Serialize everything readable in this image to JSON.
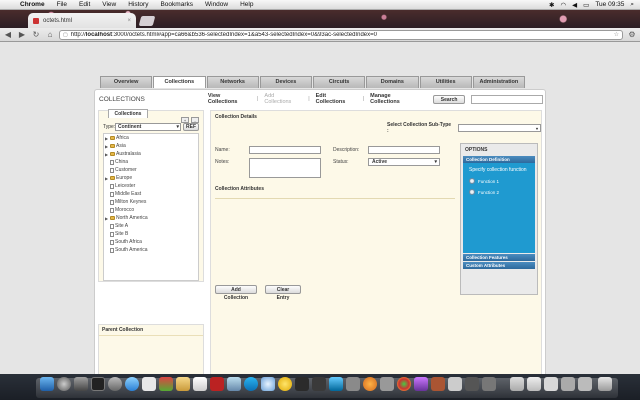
{
  "menubar": {
    "app": "Chrome",
    "items": [
      "File",
      "Edit",
      "View",
      "History",
      "Bookmarks",
      "Window",
      "Help"
    ],
    "clock": "Tue 09:35"
  },
  "browser": {
    "tab_title": "octets.html",
    "url_prefix": "http://",
    "url_host": "localhost",
    "url_rest": ":3000/octets.html#app=ca66&b536-selectedIndex=1&a543-selectedIndex=0&93ac-selectedIndex=0"
  },
  "nav_tabs": [
    "Overview",
    "Collections",
    "Networks",
    "Devices",
    "Circuits",
    "Domains",
    "Utilities",
    "Administration"
  ],
  "active_tab_index": 1,
  "page": {
    "title": "COLLECTIONS",
    "links": {
      "view": "View Collections",
      "add": "Add Collections",
      "edit": "Edit Collections",
      "manage": "Manage Collections"
    },
    "search_button": "Search",
    "search_value": ""
  },
  "left": {
    "tab_label": "Collections",
    "ref_button": "REF",
    "plus_button": "+",
    "minus_button": "-",
    "type_label": "Type:",
    "type_value": "Continent",
    "tree": [
      {
        "label": "Africa",
        "kind": "folder",
        "expandable": true
      },
      {
        "label": "Asia",
        "kind": "folder",
        "expandable": true
      },
      {
        "label": "Australasia",
        "kind": "folder",
        "expandable": true
      },
      {
        "label": "China",
        "kind": "doc",
        "expandable": false
      },
      {
        "label": "Customer",
        "kind": "doc",
        "expandable": false
      },
      {
        "label": "Europe",
        "kind": "folder",
        "expandable": true
      },
      {
        "label": "Leicester",
        "kind": "doc",
        "expandable": false
      },
      {
        "label": "Middle East",
        "kind": "doc",
        "expandable": false
      },
      {
        "label": "Milton Keynes",
        "kind": "doc",
        "expandable": false
      },
      {
        "label": "Morocco",
        "kind": "doc",
        "expandable": false
      },
      {
        "label": "North America",
        "kind": "folder",
        "expandable": true
      },
      {
        "label": "Site A",
        "kind": "doc",
        "expandable": false
      },
      {
        "label": "Site B",
        "kind": "doc",
        "expandable": false
      },
      {
        "label": "South Africa",
        "kind": "doc",
        "expandable": false
      },
      {
        "label": "South America",
        "kind": "doc",
        "expandable": false
      }
    ],
    "parent_header": "Parent Collection"
  },
  "details": {
    "header": "Collection Details",
    "subtype_label": "Select Collection Sub-Type :",
    "subtype_value": "",
    "name_label": "Name:",
    "name_value": "",
    "notes_label": "Notes:",
    "notes_value": "",
    "description_label": "Description:",
    "description_value": "",
    "status_label": "Status:",
    "status_value": "Active",
    "attributes_header": "Collection Attributes",
    "add_button": "Add Collection",
    "clear_button": "Clear Entry"
  },
  "options": {
    "header": "OPTIONS",
    "definition": "Collection Definition",
    "prompt": "Specify collection function",
    "functions": [
      "Function 1",
      "Function 2"
    ],
    "features": "Collection Features",
    "custom": "Custom Attributes"
  }
}
